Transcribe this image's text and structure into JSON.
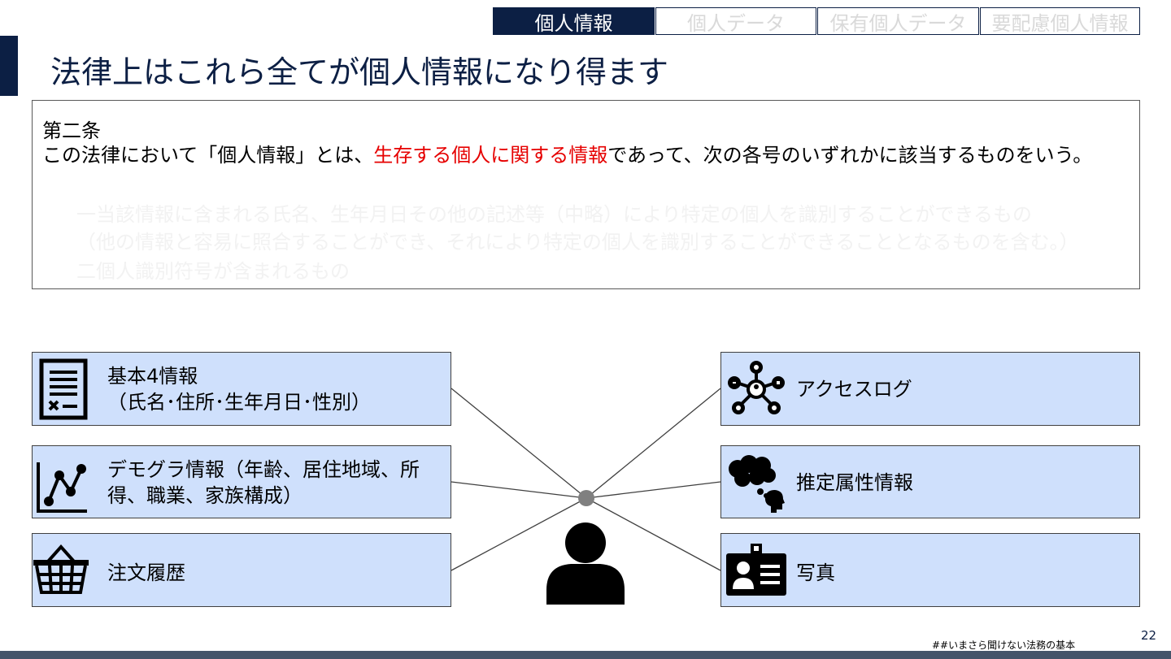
{
  "tabs": [
    {
      "label": "個人情報",
      "active": true
    },
    {
      "label": "個人データ",
      "active": false
    },
    {
      "label": "保有個人データ",
      "active": false
    },
    {
      "label": "要配慮個人情報",
      "active": false
    }
  ],
  "title": "法律上はこれら全てが個人情報になり得ます",
  "law": {
    "heading": "第二条",
    "text_before": "この法律において「個人情報」とは、",
    "text_highlight": "生存する個人に関する情報",
    "text_after": "であって、次の各号のいずれかに該当するものをいう。",
    "item1_line1": "一当該情報に含まれる氏名、生年月日その他の記述等（中略）により特定の個人を識別することができるもの",
    "item1_line2": "（他の情報と容易に照合することができ、それにより特定の個人を識別することができることとなるものを含む。）",
    "item2": "二個人識別符号が含まれるもの"
  },
  "left_cards": [
    {
      "line1": "基本4情報",
      "line2": "（氏名･住所･生年月日･性別）",
      "icon": "document-icon"
    },
    {
      "line1": "デモグラ情報（年齢、居住地域、所",
      "line2": "得、職業、家族構成）",
      "icon": "line-chart-icon"
    },
    {
      "line1": "注文履歴",
      "line2": "",
      "icon": "basket-icon"
    }
  ],
  "right_cards": [
    {
      "line1": "アクセスログ",
      "icon": "network-icon"
    },
    {
      "line1": "推定属性情報",
      "icon": "thinking-head-icon"
    },
    {
      "line1": "写真",
      "icon": "id-card-icon"
    }
  ],
  "footer": {
    "note": "##いまさら聞けない法務の基本",
    "page": "22"
  },
  "colors": {
    "navy": "#0c1f44",
    "card_fill": "#cfe0fc",
    "highlight": "#e60000",
    "hub": "#808080"
  }
}
